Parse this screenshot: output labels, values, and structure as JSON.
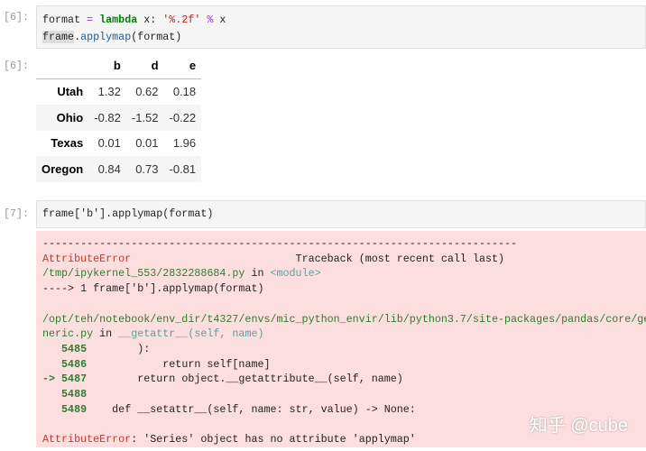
{
  "cell1": {
    "prompt": "[6]:",
    "code_lines": [
      [
        "format",
        " = ",
        "lambda",
        " x: ",
        "'%.2f'",
        " ",
        "%",
        " x"
      ],
      [
        "frame",
        ".",
        "applymap",
        "(format)"
      ]
    ],
    "out_prompt": "[6]:"
  },
  "table": {
    "columns": [
      "",
      "b",
      "d",
      "e"
    ],
    "rows": [
      [
        "Utah",
        "1.32",
        "0.62",
        "0.18"
      ],
      [
        "Ohio",
        "-0.82",
        "-1.52",
        "-0.22"
      ],
      [
        "Texas",
        "0.01",
        "0.01",
        "1.96"
      ],
      [
        "Oregon",
        "0.84",
        "0.73",
        "-0.81"
      ]
    ]
  },
  "cell2": {
    "prompt": "[7]:",
    "code": "frame['b'].applymap(format)"
  },
  "error": {
    "dashes": "---------------------------------------------------------------------------",
    "ename": "AttributeError",
    "traceback_label": "                          Traceback (most recent call last)",
    "file1": "/tmp/ipykernel_553/2832288684.py",
    "in": " in ",
    "module": "<module>",
    "arrow1": "----> 1 frame['b'].applymap(format)",
    "file2a": "/opt/teh/notebook/env_dir/t4327/envs/mic_python_envir/lib/python3.7/site-packages/pandas/core/ge",
    "file2b": "neric.py",
    "func": "__getattr__(self, name)",
    "l5485": "   5485",
    "c5485": "        ):",
    "l5486": "   5486",
    "c5486": "            return self[name]",
    "l5487": "-> 5487",
    "c5487": "        return object.__getattribute__(self, name)",
    "l5488": "   5488",
    "l5489": "   5489",
    "c5489": "    def __setattr__(self, name: str, value) -> None:",
    "final_msg": ": 'Series' object has no attribute 'applymap'"
  },
  "watermark": "知乎 @cube"
}
